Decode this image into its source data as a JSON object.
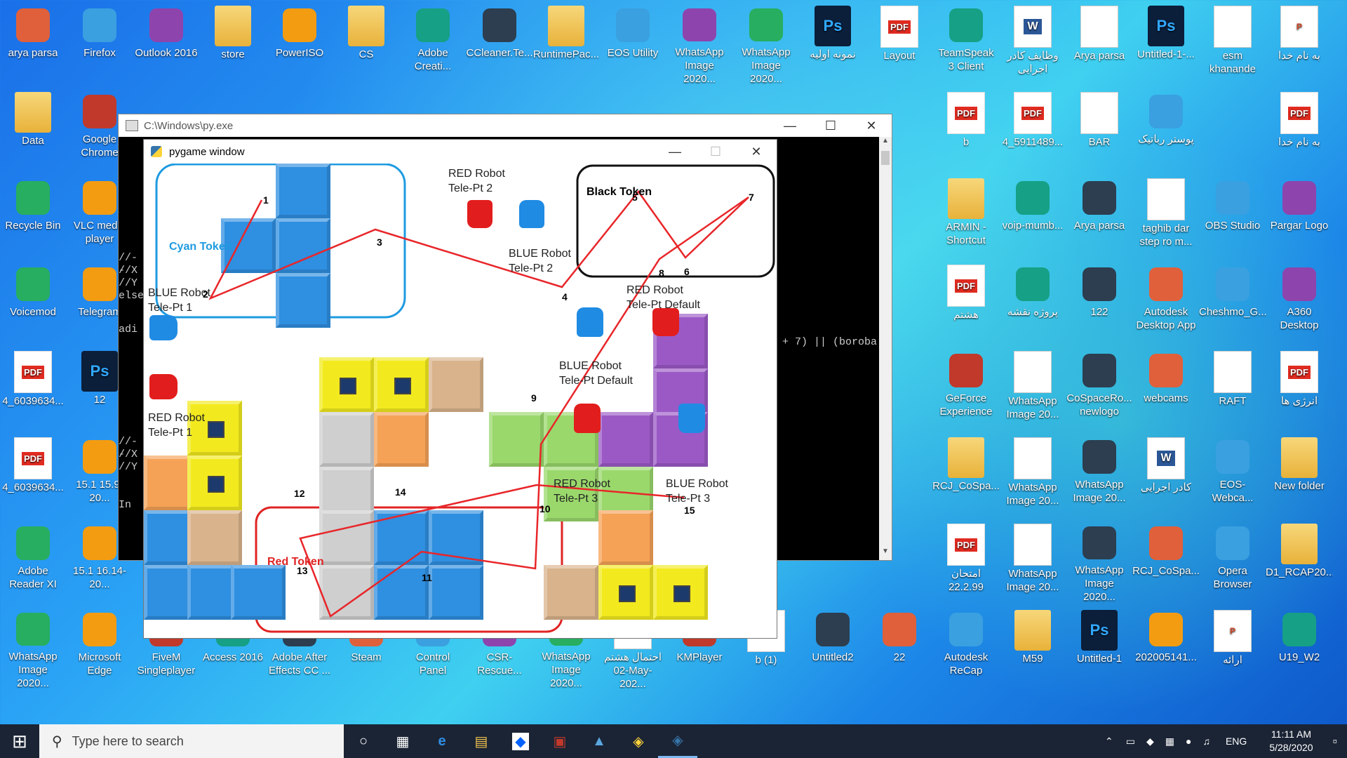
{
  "desktop": {
    "icons": [
      {
        "label": "arya parsa",
        "icon": "user-icon",
        "row": 0,
        "col": 0
      },
      {
        "label": "Firefox",
        "icon": "firefox-icon",
        "row": 0,
        "col": 1
      },
      {
        "label": "Outlook 2016",
        "icon": "outlook-icon",
        "row": 0,
        "col": 2
      },
      {
        "label": "store",
        "icon": "folder-icon",
        "row": 0,
        "col": 3
      },
      {
        "label": "PowerISO",
        "icon": "poweriso-icon",
        "row": 0,
        "col": 4
      },
      {
        "label": "CS",
        "icon": "folder-icon",
        "row": 0,
        "col": 5
      },
      {
        "label": "Adobe Creati...",
        "icon": "adobe-cc-icon",
        "row": 0,
        "col": 6
      },
      {
        "label": "CCleaner.Te...",
        "icon": "archive-icon",
        "row": 0,
        "col": 7
      },
      {
        "label": "RuntimePac...",
        "icon": "folder-icon",
        "row": 0,
        "col": 8
      },
      {
        "label": "EOS Utility",
        "icon": "camera-icon",
        "row": 0,
        "col": 9
      },
      {
        "label": "WhatsApp Image 2020...",
        "icon": "image-icon",
        "row": 0,
        "col": 10
      },
      {
        "label": "WhatsApp Image 2020...",
        "icon": "image-icon",
        "row": 0,
        "col": 11
      },
      {
        "label": "نمونه اولیه",
        "icon": "psd-icon",
        "row": 0,
        "col": 12
      },
      {
        "label": "Layout",
        "icon": "pdf-icon",
        "row": 0,
        "col": 13
      },
      {
        "label": "TeamSpeak 3 Client",
        "icon": "teamspeak-icon",
        "row": 0,
        "col": 14
      },
      {
        "label": "وظایف کادر اجرایی",
        "icon": "word-icon",
        "row": 0,
        "col": 15
      },
      {
        "label": "Arya parsa",
        "icon": "document-icon",
        "row": 0,
        "col": 16
      },
      {
        "label": "Untitled-1-...",
        "icon": "psd-icon",
        "row": 0,
        "col": 17
      },
      {
        "label": "esm khanande",
        "icon": "document-icon",
        "row": 0,
        "col": 18
      },
      {
        "label": "به نام خدا",
        "icon": "pptx-icon",
        "row": 0,
        "col": 19
      },
      {
        "label": "Data",
        "icon": "folder-icon",
        "row": 1,
        "col": 0
      },
      {
        "label": "Google Chrome",
        "icon": "chrome-icon",
        "row": 1,
        "col": 1
      },
      {
        "label": "b",
        "icon": "pdf-icon",
        "row": 1,
        "col": 14
      },
      {
        "label": "4_5911489...",
        "icon": "pdf-icon",
        "row": 1,
        "col": 15
      },
      {
        "label": "BAR",
        "icon": "document-icon",
        "row": 1,
        "col": 16
      },
      {
        "label": "پوستر رباتیک",
        "icon": "image-icon",
        "row": 1,
        "col": 17
      },
      {
        "label": "به نام خدا",
        "icon": "pdf-icon",
        "row": 1,
        "col": 19
      },
      {
        "label": "Recycle Bin",
        "icon": "recycle-bin-icon",
        "row": 2,
        "col": 0
      },
      {
        "label": "VLC media player",
        "icon": "vlc-icon",
        "row": 2,
        "col": 1
      },
      {
        "label": "ARMIN - Shortcut",
        "icon": "folder-icon",
        "row": 2,
        "col": 14
      },
      {
        "label": "voip-mumb...",
        "icon": "settings-file-icon",
        "row": 2,
        "col": 15
      },
      {
        "label": "Arya parsa",
        "icon": "opera-icon",
        "row": 2,
        "col": 16
      },
      {
        "label": "taghib dar step ro m...",
        "icon": "document-icon",
        "row": 2,
        "col": 17
      },
      {
        "label": "OBS Studio",
        "icon": "obs-icon",
        "row": 2,
        "col": 18
      },
      {
        "label": "Pargar Logo",
        "icon": "logo-icon",
        "row": 2,
        "col": 19
      },
      {
        "label": "Voicemod",
        "icon": "voicemod-icon",
        "row": 3,
        "col": 0
      },
      {
        "label": "Telegram",
        "icon": "telegram-icon",
        "row": 3,
        "col": 1
      },
      {
        "label": "هشتم",
        "icon": "pdf-icon",
        "row": 3,
        "col": 14
      },
      {
        "label": "پروژه نقشه",
        "icon": "video-icon",
        "row": 3,
        "col": 15
      },
      {
        "label": "122",
        "icon": "image-icon",
        "row": 3,
        "col": 16
      },
      {
        "label": "Autodesk Desktop App",
        "icon": "autodesk-icon",
        "row": 3,
        "col": 17
      },
      {
        "label": "Cheshmo_G...",
        "icon": "image-icon",
        "row": 3,
        "col": 18
      },
      {
        "label": "A360 Desktop",
        "icon": "a360-icon",
        "row": 3,
        "col": 19
      },
      {
        "label": "4_6039634...",
        "icon": "pdf-icon",
        "row": 4,
        "col": 0
      },
      {
        "label": "12",
        "icon": "psd-icon",
        "row": 4,
        "col": 1
      },
      {
        "label": "GeForce Experience",
        "icon": "nvidia-icon",
        "row": 4,
        "col": 14
      },
      {
        "label": "WhatsApp Image 20...",
        "icon": "document-icon",
        "row": 4,
        "col": 15
      },
      {
        "label": "CoSpaceRo... newlogo",
        "icon": "image-icon",
        "row": 4,
        "col": 16
      },
      {
        "label": "webcams",
        "icon": "video-icon",
        "row": 4,
        "col": 17
      },
      {
        "label": "RAFT",
        "icon": "document-icon",
        "row": 4,
        "col": 18
      },
      {
        "label": "انرژی ها",
        "icon": "pdf-icon",
        "row": 4,
        "col": 19
      },
      {
        "label": "4_6039634...",
        "icon": "pdf-icon",
        "row": 5,
        "col": 0
      },
      {
        "label": "15.1 15.9-20...",
        "icon": "settings-file-icon",
        "row": 5,
        "col": 1
      },
      {
        "label": "RCJ_CoSpa...",
        "icon": "folder-icon",
        "row": 5,
        "col": 14
      },
      {
        "label": "WhatsApp Image 20...",
        "icon": "document-icon",
        "row": 5,
        "col": 15
      },
      {
        "label": "WhatsApp Image 20...",
        "icon": "image-icon",
        "row": 5,
        "col": 16
      },
      {
        "label": "کادر اجرایی",
        "icon": "word-icon",
        "row": 5,
        "col": 17
      },
      {
        "label": "EOS-Webca...",
        "icon": "installer-icon",
        "row": 5,
        "col": 18
      },
      {
        "label": "New folder",
        "icon": "folder-icon",
        "row": 5,
        "col": 19
      },
      {
        "label": "Adobe Reader XI",
        "icon": "acrobat-icon",
        "row": 6,
        "col": 0
      },
      {
        "label": "15.1 16.14-20...",
        "icon": "settings-file-icon",
        "row": 6,
        "col": 1
      },
      {
        "label": "امتحان 22.2.99",
        "icon": "pdf-icon",
        "row": 6,
        "col": 14
      },
      {
        "label": "WhatsApp Image 20...",
        "icon": "document-icon",
        "row": 6,
        "col": 15
      },
      {
        "label": "WhatsApp Image 2020...",
        "icon": "image-icon",
        "row": 6,
        "col": 16
      },
      {
        "label": "RCJ_CoSpa...",
        "icon": "image-icon",
        "row": 6,
        "col": 17
      },
      {
        "label": "Opera Browser",
        "icon": "opera-icon",
        "row": 6,
        "col": 18
      },
      {
        "label": "D1_RCAP20...",
        "icon": "folder-icon",
        "row": 6,
        "col": 19
      },
      {
        "label": "WhatsApp Image 2020...",
        "icon": "image-icon",
        "row": 7,
        "col": 0
      },
      {
        "label": "Microsoft Edge",
        "icon": "edge-icon",
        "row": 7,
        "col": 1
      },
      {
        "label": "FiveM Singleplayer",
        "icon": "app-icon",
        "row": 7,
        "col": 2
      },
      {
        "label": "Access 2016",
        "icon": "access-icon",
        "row": 7,
        "col": 3
      },
      {
        "label": "Adobe After Effects CC ...",
        "icon": "ae-icon",
        "row": 7,
        "col": 4
      },
      {
        "label": "Steam",
        "icon": "steam-icon",
        "row": 7,
        "col": 5
      },
      {
        "label": "Control Panel",
        "icon": "control-panel-icon",
        "row": 7,
        "col": 6
      },
      {
        "label": "CSR-Rescue...",
        "icon": "app-icon",
        "row": 7,
        "col": 7
      },
      {
        "label": "WhatsApp Image 2020...",
        "icon": "image-icon",
        "row": 7,
        "col": 8
      },
      {
        "label": "احتمال هشتم 02-May-202...",
        "icon": "document-icon",
        "row": 7,
        "col": 9
      },
      {
        "label": "KMPlayer",
        "icon": "kmplayer-icon",
        "row": 7,
        "col": 10
      },
      {
        "label": "b (1)",
        "icon": "document-icon",
        "row": 7,
        "col": 11
      },
      {
        "label": "Untitled2",
        "icon": "image-icon",
        "row": 7,
        "col": 12
      },
      {
        "label": "22",
        "icon": "image-icon",
        "row": 7,
        "col": 13
      },
      {
        "label": "Autodesk ReCap",
        "icon": "recap-icon",
        "row": 7,
        "col": 14
      },
      {
        "label": "M59",
        "icon": "folder-icon",
        "row": 7,
        "col": 15
      },
      {
        "label": "Untitled-1",
        "icon": "psd-icon",
        "row": 7,
        "col": 16
      },
      {
        "label": "202005141...",
        "icon": "image-icon",
        "row": 7,
        "col": 17
      },
      {
        "label": "ارائه",
        "icon": "pptx-icon",
        "row": 7,
        "col": 18
      },
      {
        "label": "U19_W2",
        "icon": "image-icon",
        "row": 7,
        "col": 19
      }
    ]
  },
  "console_window": {
    "title": "C:\\Windows\\py.exe",
    "text_lines": [
      "//--",
      "//X",
      "//Y",
      "else",
      "adi",
      "//--",
      "//X",
      "//Y",
      "In"
    ],
    "side_text": "+ 7) || (boroba"
  },
  "pygame_window": {
    "title": "pygame window",
    "labels": {
      "cyan_token": "Cyan Token",
      "black_token": "Black Token",
      "red_token": "Red Token",
      "red_tele2_a": "RED Robot",
      "red_tele2_b": "Tele-Pt 2",
      "blue_tele2_a": "BLUE Robot",
      "blue_tele2_b": "Tele-Pt 2",
      "blue_tele1_a": "BLUE Robot",
      "blue_tele1_b": "Tele-Pt 1",
      "red_teled_a": "RED Robot",
      "red_teled_b": "Tele-Pt Default",
      "blue_teled_a": "BLUE Robot",
      "blue_teled_b": "Tele-Pt Default",
      "red_tele1_a": "RED Robot",
      "red_tele1_b": "Tele-Pt 1",
      "red_tele3_a": "RED Robot",
      "red_tele3_b": "Tele-Pt 3",
      "blue_tele3_a": "BLUE Robot",
      "blue_tele3_b": "Tele-Pt 3"
    },
    "waypoints": [
      "1",
      "2",
      "3",
      "4",
      "5",
      "6",
      "7",
      "8",
      "9",
      "10",
      "11",
      "12",
      "13",
      "14",
      "15"
    ],
    "path_color": "#e8262a"
  },
  "taskbar": {
    "search_placeholder": "Type here to search",
    "language": "ENG",
    "time": "11:11 AM",
    "date": "5/28/2020"
  }
}
